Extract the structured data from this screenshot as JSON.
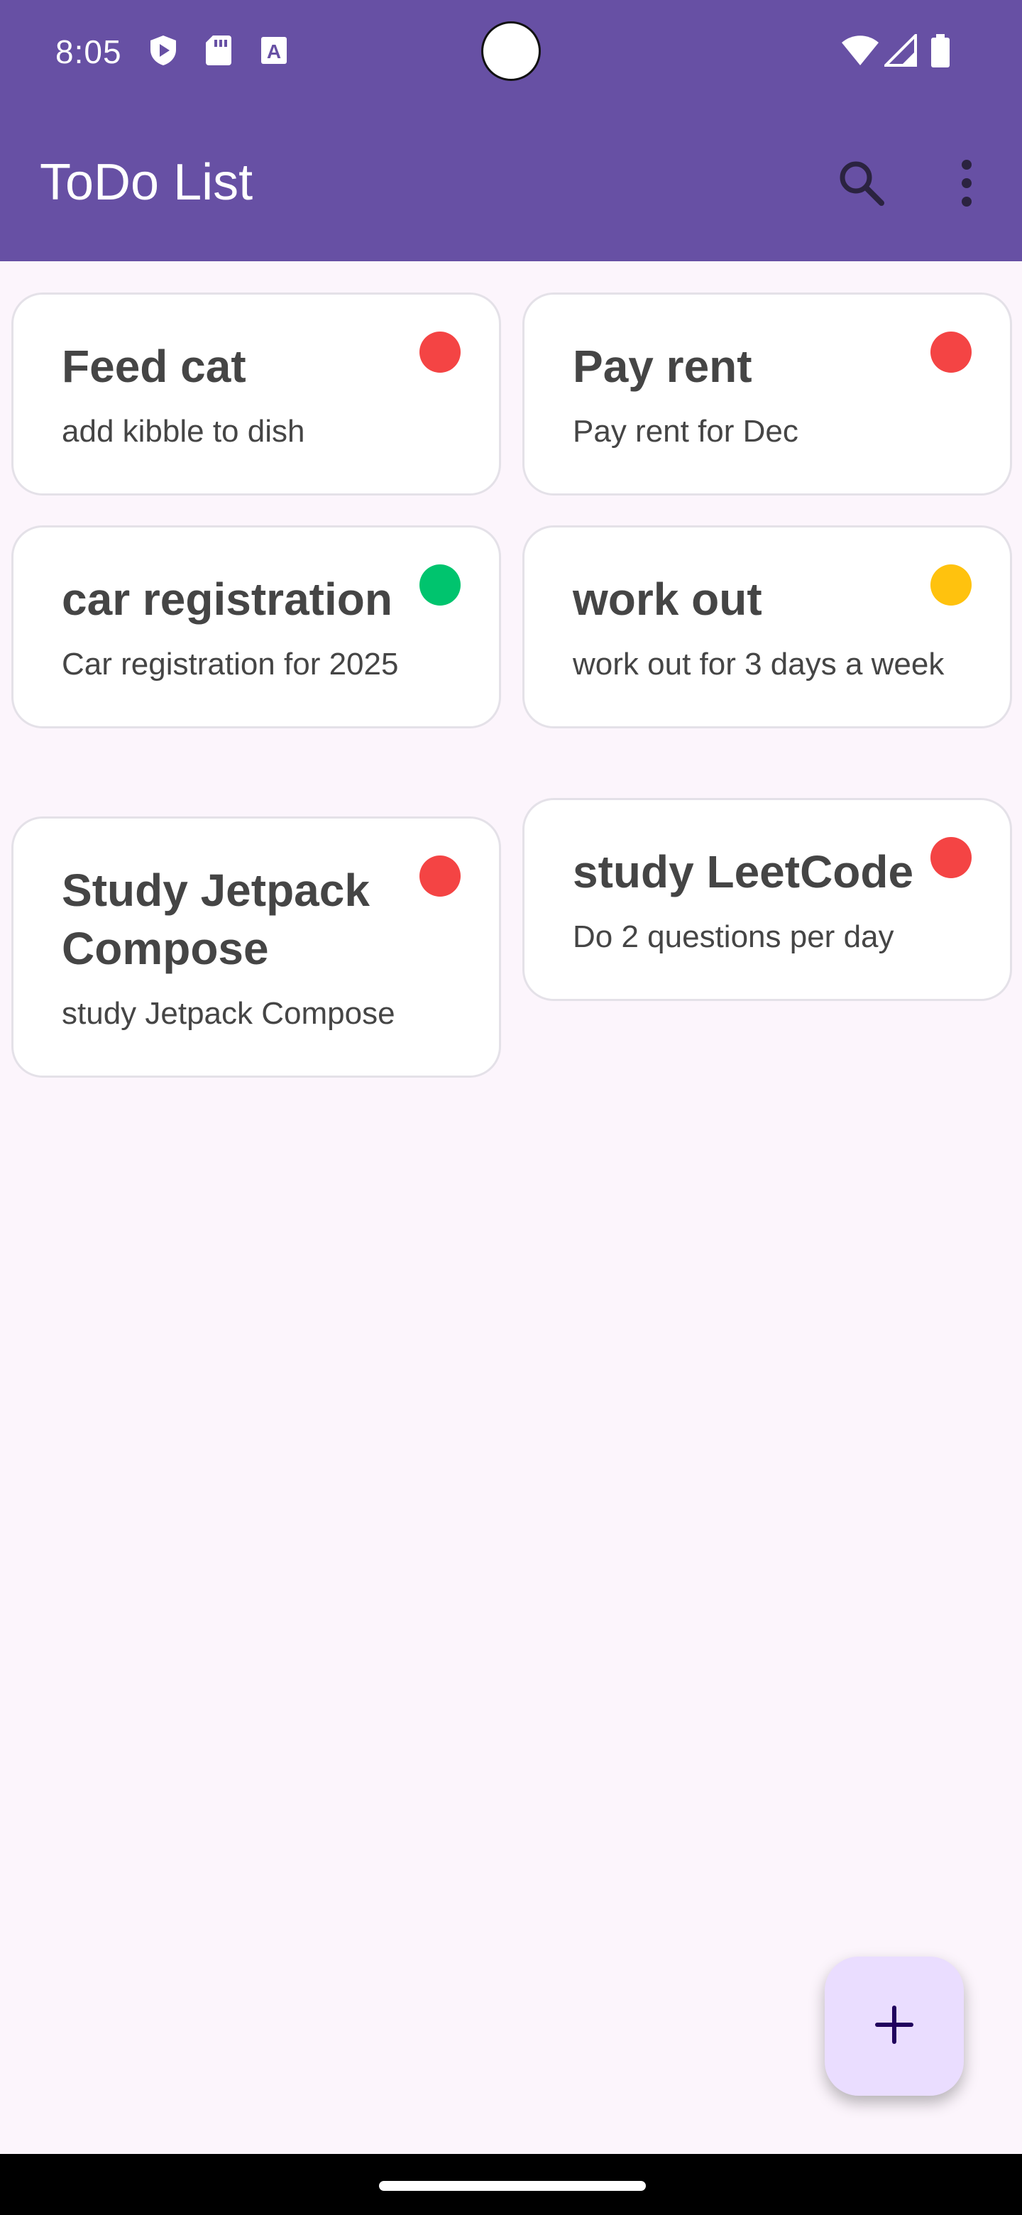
{
  "status_bar": {
    "time": "8:05",
    "left_icons": [
      "play-protect-icon",
      "sd-card-icon",
      "font-a-icon"
    ],
    "right_icons": [
      "wifi-icon",
      "signal-icon",
      "battery-icon"
    ]
  },
  "app_bar": {
    "title": "ToDo List",
    "actions": [
      "search-icon",
      "more-vert-icon"
    ]
  },
  "notes": [
    {
      "title": "Feed cat",
      "description": "add kibble to dish",
      "priority_color": "#F44444"
    },
    {
      "title": "Pay rent",
      "description": "Pay rent for Dec",
      "priority_color": "#F44444"
    },
    {
      "title": "car registration",
      "description": "Car registration for 2025",
      "priority_color": "#00C46E"
    },
    {
      "title": "work out",
      "description": "work out for 3 days a week",
      "priority_color": "#FFC20E"
    },
    {
      "title": "Study Jetpack Compose",
      "description": "study Jetpack Compose",
      "priority_color": "#F44444"
    },
    {
      "title": "study LeetCode",
      "description": "Do 2 questions per day",
      "priority_color": "#F44444"
    }
  ],
  "fab": {
    "icon": "add-icon"
  },
  "colors": {
    "primary": "#6750A4",
    "background": "#FCF5FC",
    "fab_container": "#EADDFF",
    "high_priority": "#F44444",
    "low_priority": "#00C46E",
    "medium_priority": "#FFC20E"
  }
}
